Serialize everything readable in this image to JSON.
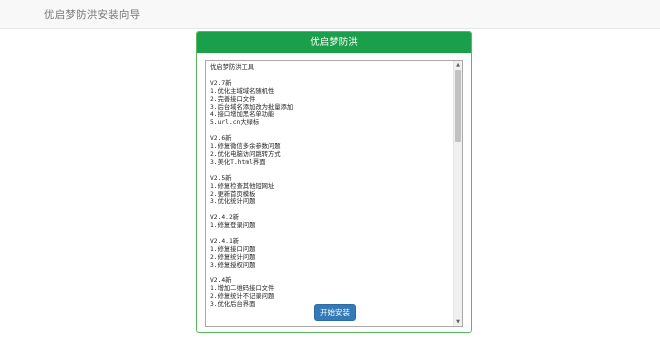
{
  "navbar": {
    "brand": "优启梦防洪安装向导"
  },
  "panel": {
    "title": "优启梦防洪"
  },
  "changelog": {
    "lines": [
      "优启梦防洪工具",
      "",
      "V2.7新",
      "1.优化主域域名随机性",
      "2.完善接口文件",
      "3.后台域名添加改为批量添加",
      "4.接口增加黑名单功能",
      "5.url.cn大绿标",
      "",
      "V2.6新",
      "1.修复微信多余参数问题",
      "2.优化电脑访问跳转方式",
      "3.美化T.html界面",
      "",
      "V2.5新",
      "1.修复检查其他短网址",
      "2.更新首页模板",
      "3.优化统计问题",
      "",
      "V2.4.2新",
      "1.修复登录问题",
      "",
      "V2.4.1新",
      "1.修复接口问题",
      "2.修复统计问题",
      "3.修复授权问题",
      "",
      "V2.4新",
      "1.增加二维码接口文件",
      "2.修复统计不记录问题",
      "3.优化后台界面"
    ]
  },
  "scroll": {
    "position": 0.0
  },
  "actions": {
    "install_label": "开始安装"
  },
  "colors": {
    "panel_header": "#1aa04b",
    "panel_border": "#5cb85c",
    "button": "#337ab7",
    "navbar": "#f8f8f8"
  },
  "icons": {
    "scroll_up": "triangle-up",
    "scroll_down": "triangle-down"
  }
}
